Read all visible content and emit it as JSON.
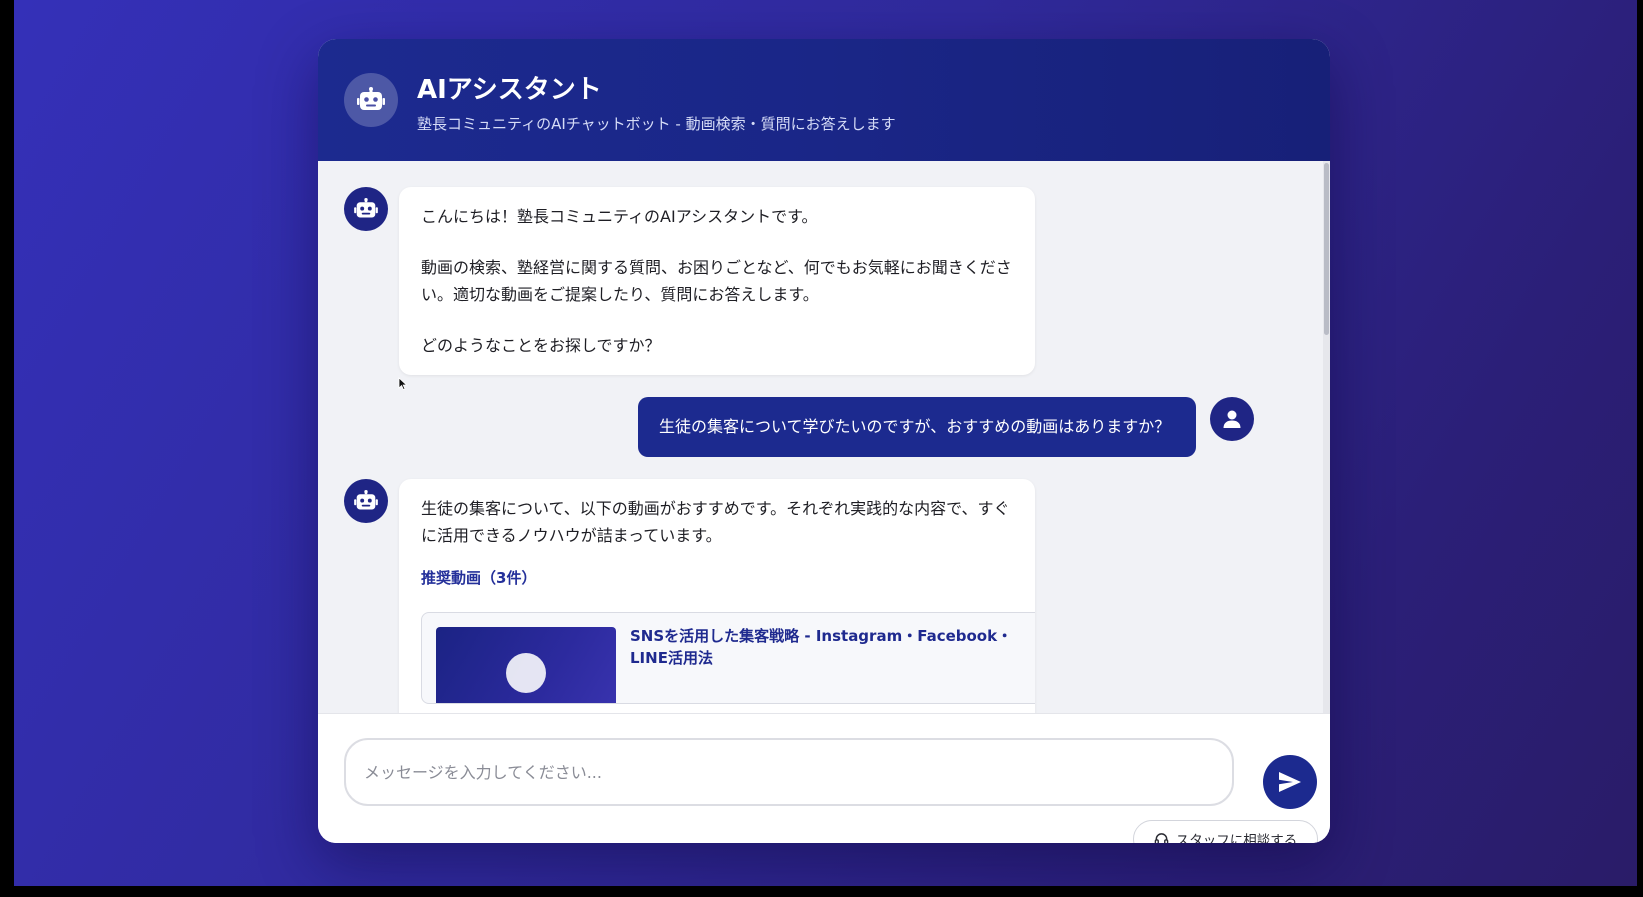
{
  "header": {
    "title": "AIアシスタント",
    "subtitle": "塾長コミュニティのAIチャットボット - 動画検索・質問にお答えします",
    "avatar_icon": "robot-icon"
  },
  "messages": [
    {
      "role": "bot",
      "paragraphs": [
        "こんにちは！塾長コミュニティのAIアシスタントです。",
        "動画の検索、塾経営に関する質問、お困りごとなど、何でもお気軽にお聞きください。適切な動画をご提案したり、質問にお答えします。",
        "どのようなことをお探しですか？"
      ]
    },
    {
      "role": "user",
      "text": "生徒の集客について学びたいのですが、おすすめの動画はありますか？"
    },
    {
      "role": "bot",
      "text": "生徒の集客について、以下の動画がおすすめです。それぞれ実践的な内容で、すぐに活用できるノウハウが詰まっています。",
      "recommend_label": "推奨動画（3件）",
      "videos": [
        {
          "title": "SNSを活用した集客戦略 - Instagram・Facebook・LINE活用法"
        }
      ]
    }
  ],
  "input": {
    "placeholder": "メッセージを入力してください...",
    "value": ""
  },
  "staff_button": {
    "label": "スタッフに相談する",
    "icon": "headset-icon"
  },
  "colors": {
    "accent": "#1c2a8f",
    "background_gradient_start": "#3430b8",
    "background_gradient_end": "#2a1c68",
    "messages_background": "#f1f2f6"
  }
}
